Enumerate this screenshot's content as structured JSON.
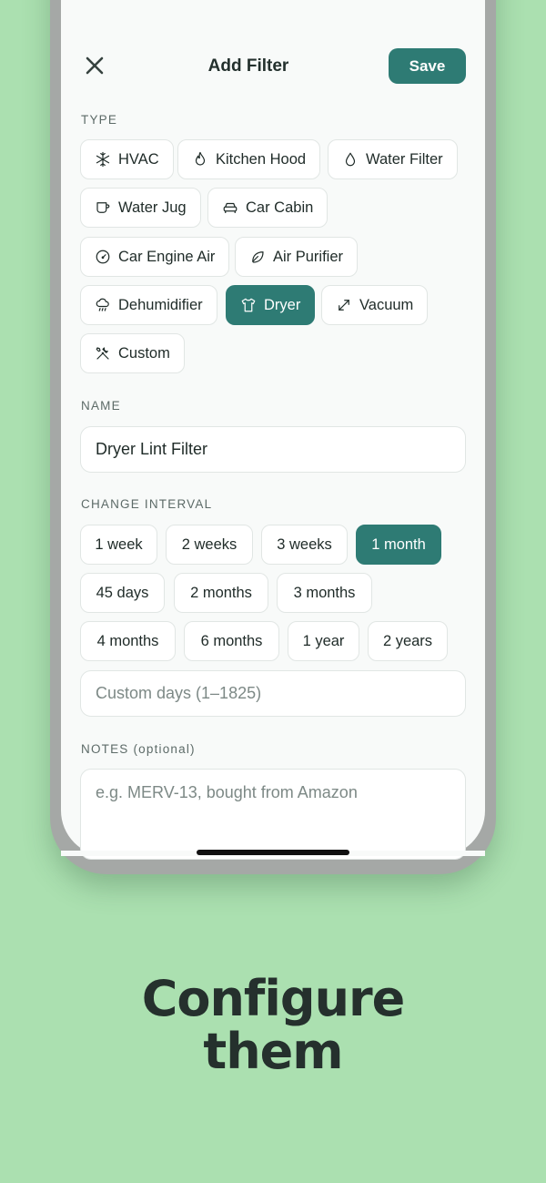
{
  "header": {
    "title": "Add Filter",
    "save_label": "Save",
    "close_icon": "close-icon"
  },
  "type_section": {
    "label": "TYPE",
    "options": [
      {
        "label": "HVAC",
        "icon": "snowflake-icon",
        "selected": false
      },
      {
        "label": "Kitchen Hood",
        "icon": "flame-icon",
        "selected": false
      },
      {
        "label": "Water Filter",
        "icon": "droplet-icon",
        "selected": false
      },
      {
        "label": "Water Jug",
        "icon": "mug-icon",
        "selected": false
      },
      {
        "label": "Car Cabin",
        "icon": "car-icon",
        "selected": false
      },
      {
        "label": "Car Engine Air",
        "icon": "gauge-icon",
        "selected": false
      },
      {
        "label": "Air Purifier",
        "icon": "leaf-icon",
        "selected": false
      },
      {
        "label": "Dehumidifier",
        "icon": "cloud-rain-icon",
        "selected": false
      },
      {
        "label": "Dryer",
        "icon": "shirt-icon",
        "selected": true
      },
      {
        "label": "Vacuum",
        "icon": "expand-arrows-icon",
        "selected": false
      },
      {
        "label": "Custom",
        "icon": "tools-icon",
        "selected": false
      }
    ]
  },
  "name_section": {
    "label": "NAME",
    "value": "Dryer Lint Filter"
  },
  "interval_section": {
    "label": "CHANGE INTERVAL",
    "options": [
      {
        "label": "1 week",
        "selected": false
      },
      {
        "label": "2 weeks",
        "selected": false
      },
      {
        "label": "3 weeks",
        "selected": false
      },
      {
        "label": "1 month",
        "selected": true
      },
      {
        "label": "45 days",
        "selected": false
      },
      {
        "label": "2 months",
        "selected": false
      },
      {
        "label": "3 months",
        "selected": false
      },
      {
        "label": "4 months",
        "selected": false
      },
      {
        "label": "6 months",
        "selected": false
      },
      {
        "label": "1 year",
        "selected": false
      },
      {
        "label": "2 years",
        "selected": false
      }
    ],
    "custom_placeholder": "Custom days (1–1825)"
  },
  "notes_section": {
    "label": "NOTES (optional)",
    "placeholder": "e.g. MERV-13, bought from Amazon"
  },
  "tagline": {
    "line1": "Configure",
    "line2": "them"
  },
  "colors": {
    "background": "#abe0b0",
    "accent": "#2e7b74",
    "text": "#23302d"
  }
}
